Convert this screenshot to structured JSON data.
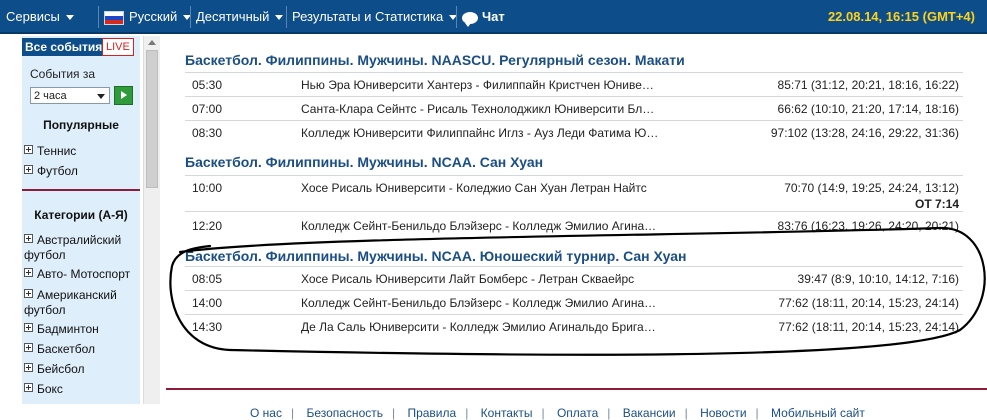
{
  "topbar": {
    "services": "Сервисы",
    "language": "Русский",
    "odds_format": "Десятичный",
    "results": "Результаты и Статистика",
    "chat": "Чат",
    "datetime": "22.08.14, 16:15 (GMT+4)"
  },
  "sidebar": {
    "tab_all": "Все события",
    "tab_live": "LIVE",
    "events_for": "События за",
    "period_value": "2 часа",
    "popular_title": "Популярные",
    "popular_items": [
      "Теннис",
      "Футбол"
    ],
    "categories_title": "Категории (А-Я)",
    "categories": [
      "Австралийский футбол",
      "Авто- Мотоспорт",
      "Американский футбол",
      "Бадминтон",
      "Баскетбол",
      "Бейсбол",
      "Бокс"
    ]
  },
  "main": {
    "sections": [
      {
        "title": "Баскетбол. Филиппины. Мужчины. NAASCU. Регулярный сезон. Макати",
        "rows": [
          {
            "time": "05:30",
            "match": "Нью Эра Юниверсити Хантерз - Филиппайн Кристчен Юниверсити",
            "score": "85:71 (31:12, 20:21, 18:16, 16:22)"
          },
          {
            "time": "07:00",
            "match": "Санта-Клара Сейнтс - Рисаль Технолоджикл Юниверсити Блейзерс",
            "score": "66:62 (10:10, 21:20, 17:14, 18:16)"
          },
          {
            "time": "08:30",
            "match": "Колледж Юниверсити Филиппайнс Иглз - Ауз Леди Фатима Юниверсити",
            "score": "97:102 (13:28, 24:16, 29:22, 31:36)"
          }
        ]
      },
      {
        "title": "Баскетбол. Филиппины. Мужчины. NCAA. Сан Хуан",
        "rows": [
          {
            "time": "10:00",
            "match": "Хосе Рисаль Юниверсити - Коледжио Сан Хуан Летран Найтс",
            "score": "70:70 (14:9, 19:25, 24:24, 13:12)",
            "extra": "OT 7:14"
          },
          {
            "time": "12:20",
            "match": "Колледж Сейнт-Бенильдо Блэйзерс - Колледж Эмилио Агинальдо",
            "score": "83:76 (16:23, 19:26, 24:20, 20:21)"
          }
        ]
      },
      {
        "title": "Баскетбол. Филиппины. Мужчины. NCAA. Юношеский турнир. Сан Хуан",
        "rows": [
          {
            "time": "08:05",
            "match": "Хосе Рисаль Юниверсити Лайт Бомберс - Летран Скваейрс",
            "score": "39:47 (8:9, 10:10, 14:12, 7:16)"
          },
          {
            "time": "14:00",
            "match": "Колледж Сейнт-Бенильдо Блэйзерс - Колледж Эмилио Агинальдо",
            "score": "77:62 (18:11, 20:14, 15:23, 24:14)"
          },
          {
            "time": "14:30",
            "match": "Де Ла Саль Юниверсити - Колледж Эмилио Агинальдо Бригадирс",
            "score": "77:62 (18:11, 20:14, 15:23, 24:14)"
          }
        ]
      }
    ]
  },
  "footer": {
    "links": [
      "О нас",
      "Безопасность",
      "Правила",
      "Контакты",
      "Оплата",
      "Вакансии",
      "Новости",
      "Мобильный сайт"
    ]
  },
  "colors": {
    "topbar": "#0d4d8a",
    "clock": "#ffd21a",
    "section_title": "#1a4e85",
    "divider": "#8c1c3a",
    "sidebar_bg": "#dfeefb"
  }
}
